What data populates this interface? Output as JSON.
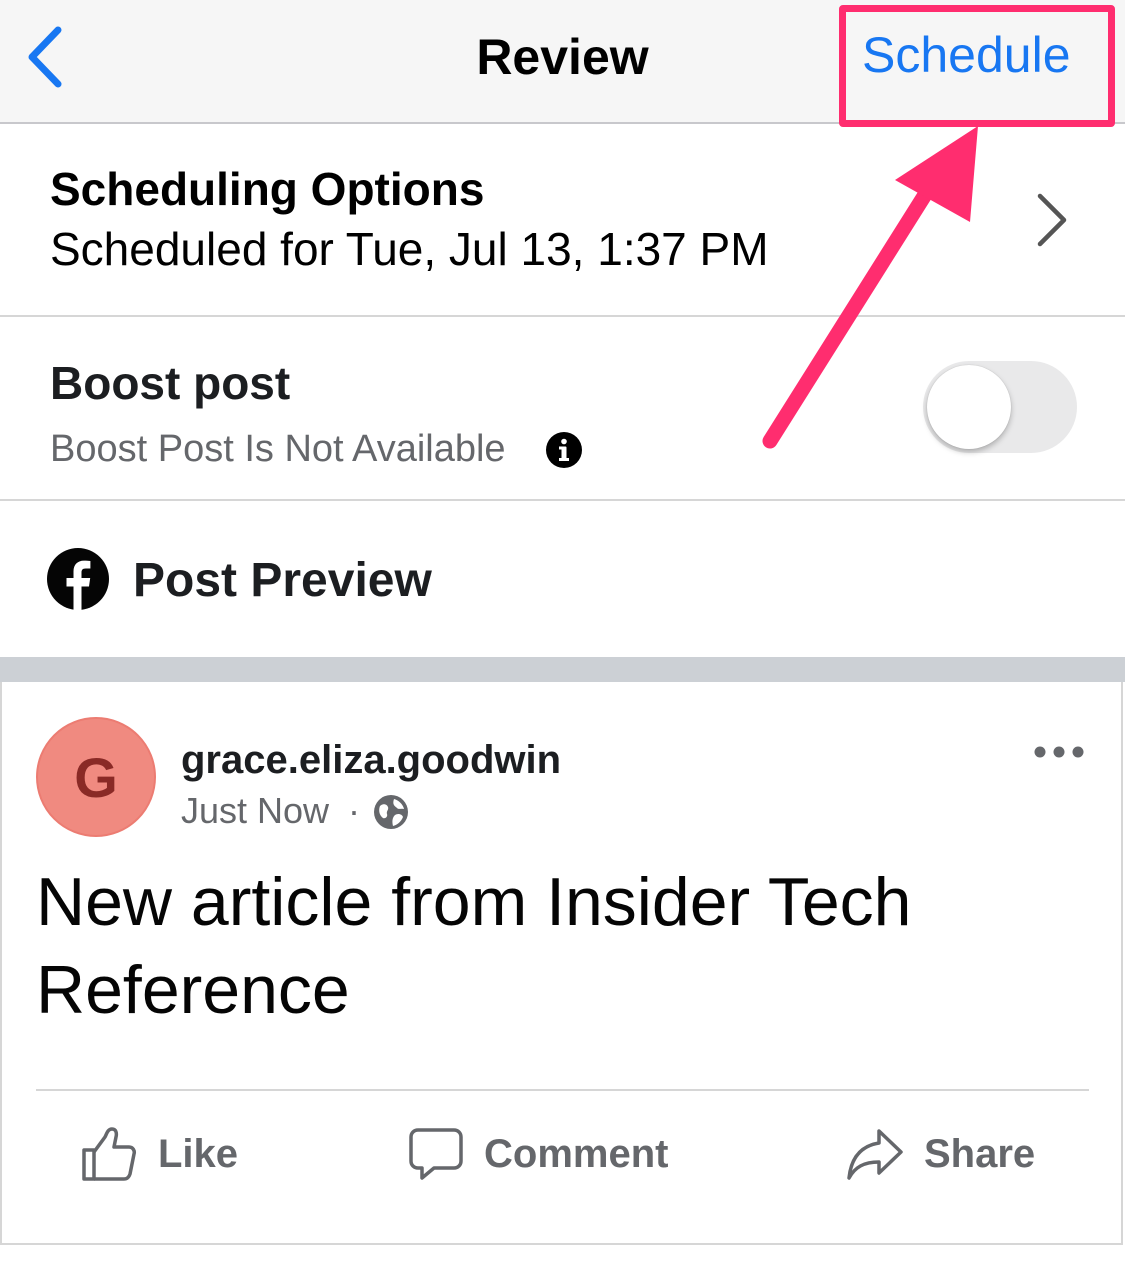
{
  "nav": {
    "title": "Review",
    "schedule_label": "Schedule"
  },
  "scheduling": {
    "title": "Scheduling Options",
    "subtitle": "Scheduled for Tue, Jul 13, 1:37 PM"
  },
  "boost": {
    "title": "Boost post",
    "subtitle": "Boost Post Is Not Available",
    "enabled": false
  },
  "preview": {
    "title": "Post Preview"
  },
  "post": {
    "avatar_letter": "G",
    "username": "grace.eliza.goodwin",
    "time": "Just Now",
    "separator": "·",
    "text": "New article from Insider Tech Reference",
    "actions": {
      "like": "Like",
      "comment": "Comment",
      "share": "Share"
    }
  },
  "icons": {
    "back": "chevron-left-icon",
    "chevron": "chevron-right-icon",
    "info": "info-icon",
    "facebook": "facebook-logo-icon",
    "globe": "globe-icon",
    "more": "more-horizontal-icon",
    "like": "thumbs-up-icon",
    "comment": "comment-bubble-icon",
    "share": "share-arrow-icon"
  },
  "colors": {
    "accent": "#1877f2",
    "annotation": "#ff2d6f",
    "avatar": "#f08a80"
  }
}
